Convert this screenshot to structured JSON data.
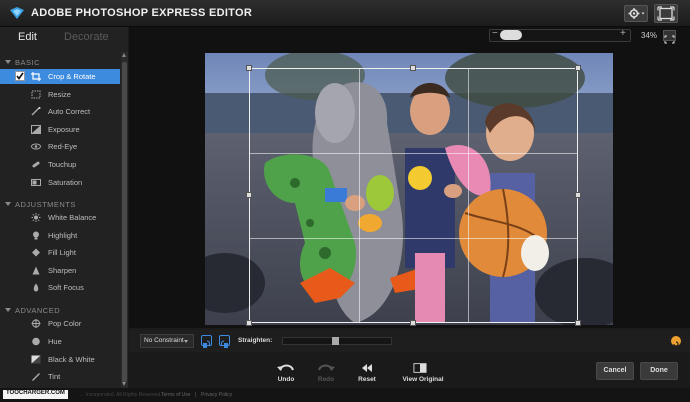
{
  "app": {
    "title": "ADOBE PHOTOSHOP EXPRESS EDITOR"
  },
  "tabs": {
    "edit": "Edit",
    "decorate": "Decorate"
  },
  "sidebar": {
    "sections": [
      {
        "label": "BASIC",
        "items": [
          {
            "label": "Crop & Rotate",
            "icon": "crop-icon",
            "selected": true
          },
          {
            "label": "Resize",
            "icon": "resize-icon"
          },
          {
            "label": "Auto Correct",
            "icon": "magic-wand-icon"
          },
          {
            "label": "Exposure",
            "icon": "exposure-icon"
          },
          {
            "label": "Red-Eye",
            "icon": "eye-icon"
          },
          {
            "label": "Touchup",
            "icon": "bandage-icon"
          },
          {
            "label": "Saturation",
            "icon": "saturation-icon"
          }
        ]
      },
      {
        "label": "ADJUSTMENTS",
        "items": [
          {
            "label": "White Balance",
            "icon": "sun-icon"
          },
          {
            "label": "Highlight",
            "icon": "lightbulb-icon"
          },
          {
            "label": "Fill Light",
            "icon": "fill-light-icon"
          },
          {
            "label": "Sharpen",
            "icon": "sharpen-icon"
          },
          {
            "label": "Soft Focus",
            "icon": "soft-focus-icon"
          }
        ]
      },
      {
        "label": "ADVANCED",
        "items": [
          {
            "label": "Pop Color",
            "icon": "pop-color-icon"
          },
          {
            "label": "Hue",
            "icon": "hue-icon"
          },
          {
            "label": "Black & White",
            "icon": "black-white-icon"
          },
          {
            "label": "Tint",
            "icon": "tint-icon"
          }
        ]
      }
    ]
  },
  "zoom": {
    "minus": "−",
    "plus": "+",
    "value": "34%",
    "level": 0.34
  },
  "crop_toolbar": {
    "constraint": "No Constraint",
    "straighten_label": "Straighten:",
    "straighten_level": 0.5
  },
  "actions": {
    "undo": "Undo",
    "redo": "Redo",
    "reset": "Reset",
    "view_original": "View Original",
    "cancel": "Cancel",
    "done": "Done"
  },
  "footer": {
    "watermark": "TOOCHARGER.COM",
    "copyright": "... Incorporated. All Rights Reserved.",
    "terms": "Terms of Use",
    "separator": "|",
    "privacy": "Privacy Policy"
  },
  "colors": {
    "accent": "#3c8bde",
    "reset_icon": "#f0a030"
  }
}
